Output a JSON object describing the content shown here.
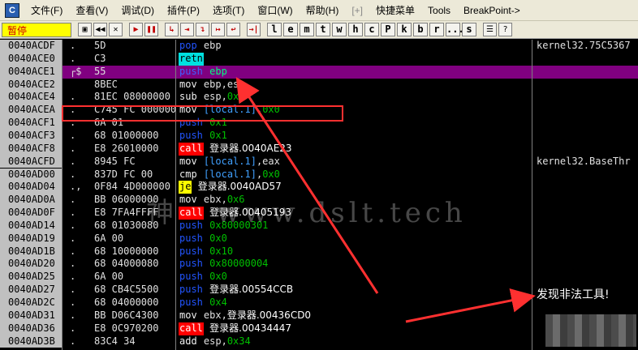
{
  "app": {
    "icon_glyph": "C"
  },
  "menu": [
    "文件(F)",
    "查看(V)",
    "调试(D)",
    "插件(P)",
    "选项(T)",
    "窗口(W)",
    "帮助(H)",
    "[+]",
    "快捷菜单",
    "Tools",
    "BreakPoint->"
  ],
  "toolbar": {
    "status": "暂停",
    "buttons": [
      "open-icon",
      "rewind-icon",
      "close-icon",
      "play-icon",
      "pause-icon",
      "step-into-icon",
      "step-over-icon",
      "trace-into-icon",
      "trace-over-icon",
      "execute-till-return-icon",
      "go-to-icon"
    ],
    "letters": [
      "l",
      "e",
      "m",
      "t",
      "w",
      "h",
      "c",
      "P",
      "k",
      "b",
      "r",
      "...",
      "s"
    ],
    "extra": [
      "list-icon",
      "help-icon"
    ]
  },
  "rows": [
    {
      "addr": "0040ACDF",
      "mark": ".",
      "hex": "5D",
      "mn": "pop",
      "mnClass": "pop",
      "ops": [
        [
          "reg",
          "ebp"
        ]
      ],
      "comment": "kernel32.75C5367"
    },
    {
      "addr": "0040ACE0",
      "mark": ".",
      "hex": "C3",
      "mn": "retn",
      "mnClass": "retn",
      "ops": [],
      "comment": ""
    },
    {
      "addr": "0040ACE1",
      "mark": "┌$",
      "hex": "55",
      "mn": "push",
      "mnClass": "push",
      "ops": [
        [
          "reg",
          "ebp"
        ]
      ],
      "comment": "",
      "selected": true
    },
    {
      "addr": "0040ACE2",
      "mark": "",
      "hex": "8BEC",
      "mn": "mov",
      "mnClass": "mov",
      "ops": [
        [
          "reg",
          "ebp,esp"
        ]
      ],
      "comment": ""
    },
    {
      "addr": "0040ACE4",
      "mark": ".",
      "hex": "81EC 08000000",
      "mn": "sub",
      "mnClass": "sub",
      "ops": [
        [
          "reg",
          "esp,"
        ],
        [
          "num",
          "0x8"
        ]
      ],
      "comment": ""
    },
    {
      "addr": "0040ACEA",
      "mark": ".",
      "hex": "C745 FC 00000000",
      "mn": "mov",
      "mnClass": "mov",
      "ops": [
        [
          "mem",
          "[local.1]"
        ],
        [
          "reg",
          ","
        ],
        [
          "num",
          "0x0"
        ]
      ],
      "comment": ""
    },
    {
      "addr": "0040ACF1",
      "mark": ".",
      "hex": "6A 01",
      "mn": "push",
      "mnClass": "push",
      "ops": [
        [
          "num",
          "0x1"
        ]
      ],
      "comment": ""
    },
    {
      "addr": "0040ACF3",
      "mark": ".",
      "hex": "68 01000000",
      "mn": "push",
      "mnClass": "push",
      "ops": [
        [
          "num",
          "0x1"
        ]
      ],
      "comment": ""
    },
    {
      "addr": "0040ACF8",
      "mark": ".",
      "hex": "E8 26010000",
      "mn": "call",
      "mnClass": "call",
      "ops": [
        [
          "sym",
          "登录器.0040AE23"
        ]
      ],
      "comment": ""
    },
    {
      "addr": "0040ACFD",
      "mark": ".",
      "hex": "8945 FC",
      "mn": "mov",
      "mnClass": "mov",
      "ops": [
        [
          "mem",
          "[local.1]"
        ],
        [
          "reg",
          ",eax"
        ]
      ],
      "comment": "kernel32.BaseThr"
    },
    {
      "addr": "0040AD00",
      "mark": ".",
      "hex": "837D FC 00",
      "mn": "cmp",
      "mnClass": "cmp",
      "ops": [
        [
          "mem",
          "[local.1]"
        ],
        [
          "reg",
          ","
        ],
        [
          "num",
          "0x0"
        ]
      ],
      "comment": ""
    },
    {
      "addr": "0040AD04",
      "mark": ".,",
      "hex": "0F84 4D000000",
      "mn": "je",
      "mnClass": "je",
      "ops": [
        [
          "sym",
          "登录器.0040AD57"
        ]
      ],
      "comment": ""
    },
    {
      "addr": "0040AD0A",
      "mark": ".",
      "hex": "BB 06000000",
      "mn": "mov",
      "mnClass": "mov",
      "ops": [
        [
          "reg",
          "ebx,"
        ],
        [
          "num",
          "0x6"
        ]
      ],
      "comment": ""
    },
    {
      "addr": "0040AD0F",
      "mark": ".",
      "hex": "E8 7FA4FFFF",
      "mn": "call",
      "mnClass": "call",
      "ops": [
        [
          "sym",
          "登录器.00405193"
        ]
      ],
      "comment": ""
    },
    {
      "addr": "0040AD14",
      "mark": ".",
      "hex": "68 01030080",
      "mn": "push",
      "mnClass": "push",
      "ops": [
        [
          "num",
          "0x80000301"
        ]
      ],
      "comment": ""
    },
    {
      "addr": "0040AD19",
      "mark": ".",
      "hex": "6A 00",
      "mn": "push",
      "mnClass": "push",
      "ops": [
        [
          "num",
          "0x0"
        ]
      ],
      "comment": ""
    },
    {
      "addr": "0040AD1B",
      "mark": ".",
      "hex": "68 10000000",
      "mn": "push",
      "mnClass": "push",
      "ops": [
        [
          "num",
          "0x10"
        ]
      ],
      "comment": ""
    },
    {
      "addr": "0040AD20",
      "mark": ".",
      "hex": "68 04000080",
      "mn": "push",
      "mnClass": "push",
      "ops": [
        [
          "num",
          "0x80000004"
        ]
      ],
      "comment": ""
    },
    {
      "addr": "0040AD25",
      "mark": ".",
      "hex": "6A 00",
      "mn": "push",
      "mnClass": "push",
      "ops": [
        [
          "num",
          "0x0"
        ]
      ],
      "comment": ""
    },
    {
      "addr": "0040AD27",
      "mark": ".",
      "hex": "68 CB4C5500",
      "mn": "push",
      "mnClass": "push",
      "ops": [
        [
          "sym",
          "登录器.00554CCB"
        ]
      ],
      "comment": ""
    },
    {
      "addr": "0040AD2C",
      "mark": ".",
      "hex": "68 04000000",
      "mn": "push",
      "mnClass": "push",
      "ops": [
        [
          "num",
          "0x4"
        ]
      ],
      "comment": ""
    },
    {
      "addr": "0040AD31",
      "mark": ".",
      "hex": "BB D06C4300",
      "mn": "mov",
      "mnClass": "mov",
      "ops": [
        [
          "reg",
          "ebx,"
        ],
        [
          "sym",
          "登录器.00436CD0"
        ]
      ],
      "comment": ""
    },
    {
      "addr": "0040AD36",
      "mark": ".",
      "hex": "E8 0C970200",
      "mn": "call",
      "mnClass": "call",
      "ops": [
        [
          "sym",
          "登录器.00434447"
        ]
      ],
      "comment": ""
    },
    {
      "addr": "0040AD3B",
      "mark": ".",
      "hex": "83C4 34",
      "mn": "add",
      "mnClass": "add",
      "ops": [
        [
          "reg",
          "esp,"
        ],
        [
          "num",
          "0x34"
        ]
      ],
      "comment": ""
    }
  ],
  "overlay": {
    "watermark": "www.dslt.tech",
    "watermark_prefix": "神",
    "warning": "发现非法工具!"
  },
  "colors": {
    "selected_row": "#800080",
    "annotation_red": "#ff3030",
    "status_bg": "#ffff00"
  }
}
